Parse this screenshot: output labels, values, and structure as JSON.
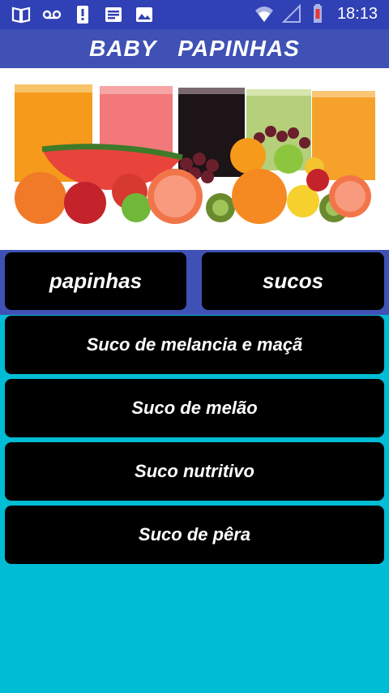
{
  "status_bar": {
    "time": "18:13",
    "icons": [
      "book-icon",
      "voicemail-icon",
      "alert-icon",
      "news-icon",
      "image-icon",
      "wifi-icon",
      "signal-icon",
      "battery-icon"
    ]
  },
  "app": {
    "title": "BABY   PAPINHAS"
  },
  "hero": {
    "alt": "fruit-juices-image"
  },
  "tabs": [
    {
      "label": "papinhas"
    },
    {
      "label": "sucos"
    }
  ],
  "recipes": [
    {
      "label": "Suco de melancia e maçã"
    },
    {
      "label": "Suco de melão"
    },
    {
      "label": "Suco nutritivo"
    },
    {
      "label": "Suco de pêra"
    }
  ],
  "colors": {
    "status_bar": "#3040b5",
    "app_bar": "#3f51b5",
    "background": "#00bcd4",
    "button": "#000000",
    "button_text": "#ffffff"
  }
}
